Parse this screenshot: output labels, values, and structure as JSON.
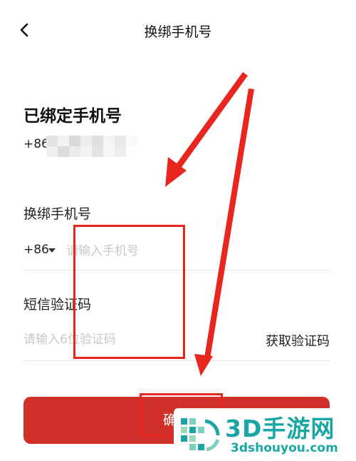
{
  "header": {
    "title": "换绑手机号",
    "back_icon": "chevron-left-icon"
  },
  "bound": {
    "heading": "已绑定手机号",
    "number_prefix": "+86",
    "mosaic_colors": [
      "#e4e4e4",
      "#f2f2f2",
      "#d9d9d9",
      "#eeeeee",
      "#e0e0e0",
      "#f5f5f5",
      "#e8e8e8",
      "#fafafa",
      "#f0f0f0",
      "#dcdcdc",
      "#ebebeb",
      "#f4f4f4",
      "#e3e3e3",
      "#f7f7f7",
      "#ededed",
      "#ffffff"
    ]
  },
  "phone": {
    "label": "换绑手机号",
    "country_code": "+86",
    "placeholder": "请输入手机号"
  },
  "sms": {
    "label": "短信验证码",
    "placeholder": "请输入6位验证码",
    "get_code_label": "获取验证码"
  },
  "confirm": {
    "label": "确认"
  },
  "colors": {
    "accent_red": "#d12f2a",
    "annotation_red": "#e8261f",
    "watermark_teal": "#1ba6a6"
  },
  "watermark": {
    "brand": "3D手游网",
    "url": "3dshouyou.com"
  }
}
